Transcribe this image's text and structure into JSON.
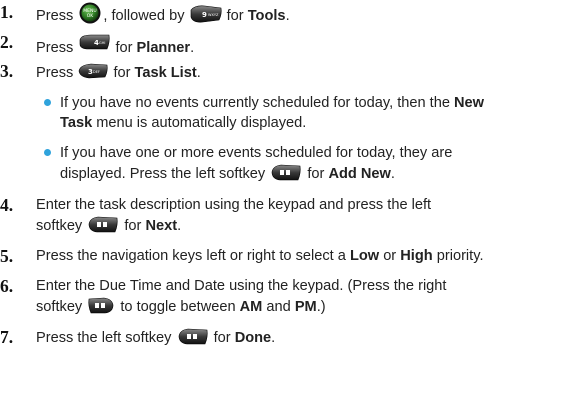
{
  "steps": [
    {
      "num": "1.",
      "a": "Press",
      "b": ", followed by",
      "c": "for",
      "d": "Tools",
      "e": "."
    },
    {
      "num": "2.",
      "a": "Press",
      "c": "for",
      "d": "Planner",
      "e": "."
    },
    {
      "num": "3.",
      "a": "Press",
      "c": "for",
      "d": "Task List",
      "e": "."
    },
    {
      "num": "4.",
      "l1": "Enter the task description using the keypad and press the left",
      "l2a": "softkey",
      "l2b": "for",
      "l2c": "Next",
      "l2d": "."
    },
    {
      "num": "5.",
      "a": "Press the navigation keys left or right to select a",
      "b1": "Low",
      "or": "or",
      "b2": "High",
      "e": "priority."
    },
    {
      "num": "6.",
      "l1": "Enter the Due Time and Date using the keypad. (Press the right",
      "l2a": "softkey",
      "l2b": "to toggle between",
      "l2c": "AM",
      "and": "and",
      "l2e": "PM",
      "l2f": ".)"
    },
    {
      "num": "7.",
      "a": "Press the left softkey",
      "c": "for",
      "d": "Done",
      "e": "."
    }
  ],
  "bullets": [
    {
      "l1a": "If you have no events currently scheduled for today, then the",
      "l1b": "New",
      "l2a": "Task",
      "l2b": "menu is automatically displayed."
    },
    {
      "l1": "If you have one or more events scheduled for today, they are",
      "l2a": "displayed. Press the left softkey",
      "l2b": "for",
      "l2c": "Add New",
      "l2d": "."
    }
  ],
  "icons": [
    "menu-ok-key-icon",
    "9-wxyz-key-icon",
    "4-ghi-key-icon",
    "3-def-key-icon",
    "left-softkey-icon",
    "right-softkey-icon"
  ]
}
